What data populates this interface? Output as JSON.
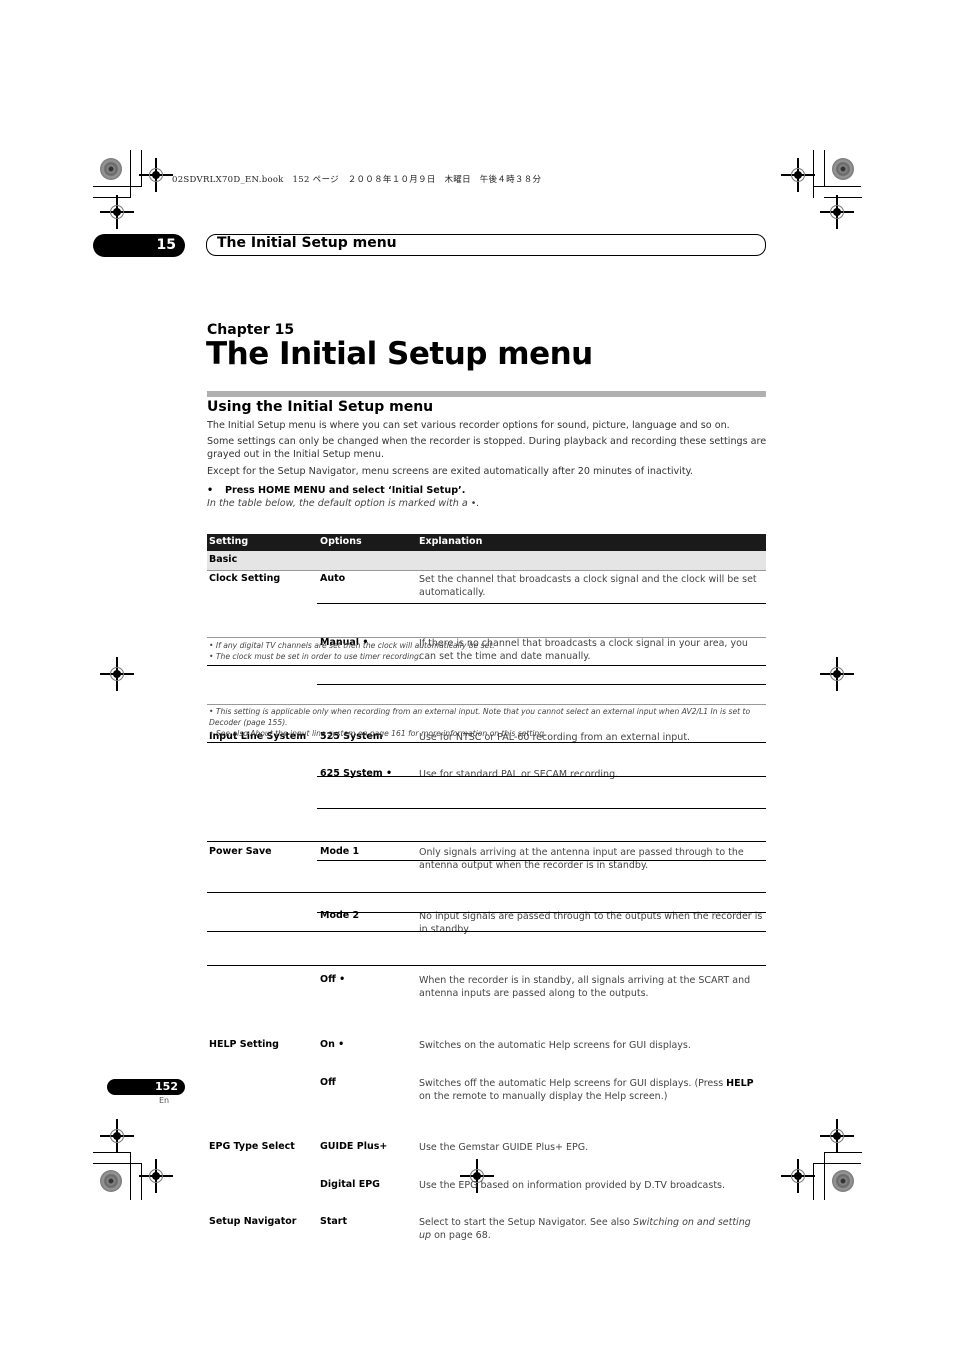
{
  "file_header": "02SDVRLX70D_EN.book　152 ページ　２００８年１０月９日　木曜日　午後４時３８分",
  "chapter_tab": {
    "number": "15",
    "title": "The Initial Setup menu"
  },
  "chapter_label": "Chapter 15",
  "page_title": "The Initial Setup menu",
  "section": {
    "title": "Using the Initial Setup menu",
    "paragraphs": [
      "The Initial Setup menu is where you can set various recorder options for sound, picture, language and so on.",
      "Some settings can only be changed when the recorder is stopped. During playback and recording these settings are grayed out in the Initial Setup menu.",
      "Except for the Setup Navigator, menu screens are exited automatically after 20 minutes of inactivity."
    ],
    "instruction_bullet": "•",
    "instruction": "Press HOME MENU and select ‘Initial Setup’.",
    "default_note": "In the table below, the default option is marked with a •."
  },
  "table": {
    "headers": [
      "Setting",
      "Options",
      "Explanation"
    ],
    "category": "Basic",
    "rows": [
      {
        "setting": "Clock Setting",
        "option": "Auto",
        "explanation": "Set the channel that broadcasts a clock signal and the clock will be set automatically."
      },
      {
        "setting": "",
        "option": "Manual •",
        "explanation": "If there is no channel that broadcasts a clock signal in your area, you can set the time and date manually."
      },
      {
        "setting": "Input Line System",
        "option": "525 System",
        "explanation": "Use for NTSC or PAL-60 recording from an external input."
      },
      {
        "setting": "",
        "option": "625 System •",
        "explanation": "Use for standard PAL or SECAM recording."
      },
      {
        "setting": "Power Save",
        "option": "Mode 1",
        "explanation": "Only signals arriving at the antenna input are passed through to the antenna output when the recorder is in standby."
      },
      {
        "setting": "",
        "option": "Mode 2",
        "explanation": "No input signals are passed through to the outputs when the recorder is in standby."
      },
      {
        "setting": "",
        "option": "Off •",
        "explanation": "When the recorder is in standby, all signals arriving at the SCART and antenna inputs are passed along to the outputs."
      },
      {
        "setting": "HELP Setting",
        "option": "On •",
        "explanation": "Switches on the automatic Help screens for GUI displays."
      },
      {
        "setting": "",
        "option": "Off",
        "explanation_pre": "Switches off the automatic Help screens for GUI displays. (Press ",
        "explanation_bold": "HELP",
        "explanation_post": " on the remote to manually display the Help screen.)"
      },
      {
        "setting": "EPG Type Select",
        "option": "GUIDE Plus+",
        "explanation": "Use the Gemstar GUIDE Plus+ EPG."
      },
      {
        "setting": "",
        "option": "Digital EPG",
        "explanation": "Use the EPG based on information provided by D.TV broadcasts."
      },
      {
        "setting": "Setup Navigator",
        "option": "Start",
        "explanation_pre": "Select to start the Setup Navigator. See also ",
        "explanation_italic": "Switching on and setting up",
        "explanation_post": " on page 68."
      }
    ],
    "footnotes_clock": [
      "• If any digital TV channels are set then the clock will automatically be set.",
      "• The clock must be set in order to use timer recording."
    ],
    "footnotes_input": [
      "• This setting is applicable only when recording from an external input. Note that you cannot select an external input when AV2/L1 In is set to Decoder (page 155).",
      "• See also About the input line system on page 161 for more information on this setting."
    ]
  },
  "footer": {
    "page_number": "152",
    "language": "En"
  }
}
